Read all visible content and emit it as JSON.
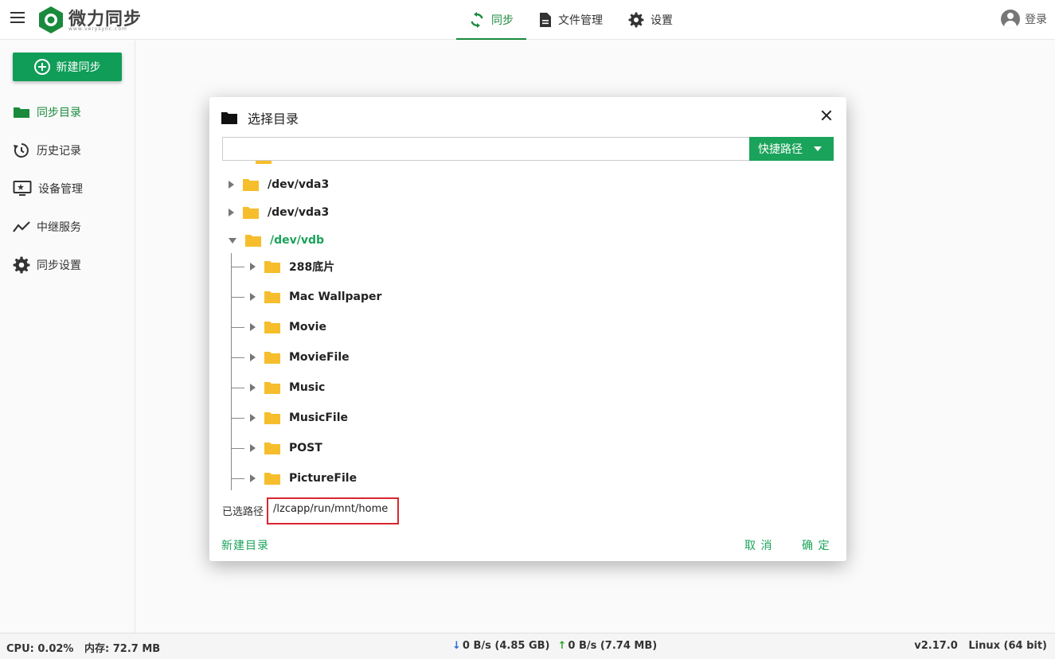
{
  "header": {
    "brand": "微力同步",
    "brand_sub": "www.verysync.com",
    "nav": [
      {
        "label": "同步",
        "icon": "sync-icon",
        "active": true
      },
      {
        "label": "文件管理",
        "icon": "file-icon",
        "active": false
      },
      {
        "label": "设置",
        "icon": "gear-icon",
        "active": false
      }
    ],
    "login_label": "登录"
  },
  "sidebar": {
    "new_sync_label": "新建同步",
    "items": [
      {
        "label": "同步目录",
        "icon": "folder-icon",
        "active": true
      },
      {
        "label": "历史记录",
        "icon": "history-icon",
        "active": false
      },
      {
        "label": "设备管理",
        "icon": "device-icon",
        "active": false
      },
      {
        "label": "中继服务",
        "icon": "relay-icon",
        "active": false
      },
      {
        "label": "同步设置",
        "icon": "gear-icon",
        "active": false
      }
    ]
  },
  "dialog": {
    "title": "选择目录",
    "path_input": "",
    "quick_path_label": "快捷路径",
    "tree": {
      "root_items": [
        {
          "label": "/dev/vda3",
          "expanded": false
        },
        {
          "label": "/dev/vda3",
          "expanded": false
        },
        {
          "label": "/dev/vdb",
          "expanded": true,
          "selected": true
        }
      ],
      "children": [
        {
          "label": "288底片"
        },
        {
          "label": "Mac Wallpaper"
        },
        {
          "label": "Movie"
        },
        {
          "label": "MovieFile"
        },
        {
          "label": "Music"
        },
        {
          "label": "MusicFile"
        },
        {
          "label": "POST"
        },
        {
          "label": "PictureFile"
        }
      ]
    },
    "selected_path_label": "已选路径",
    "selected_path": "/lzcapp/run/mnt/home",
    "new_dir_label": "新建目录",
    "cancel_label": "取 消",
    "ok_label": "确 定"
  },
  "statusbar": {
    "cpu": "CPU: 0.02%",
    "mem": "内存: 72.7 MB",
    "down": "0 B/s (4.85 GB)",
    "up": "0 B/s (7.74 MB)",
    "version": "v2.17.0",
    "os": "Linux (64 bit)"
  },
  "colors": {
    "accent": "#1aa35a",
    "folder": "#f6be2c",
    "highlight_border": "#d9262f"
  }
}
